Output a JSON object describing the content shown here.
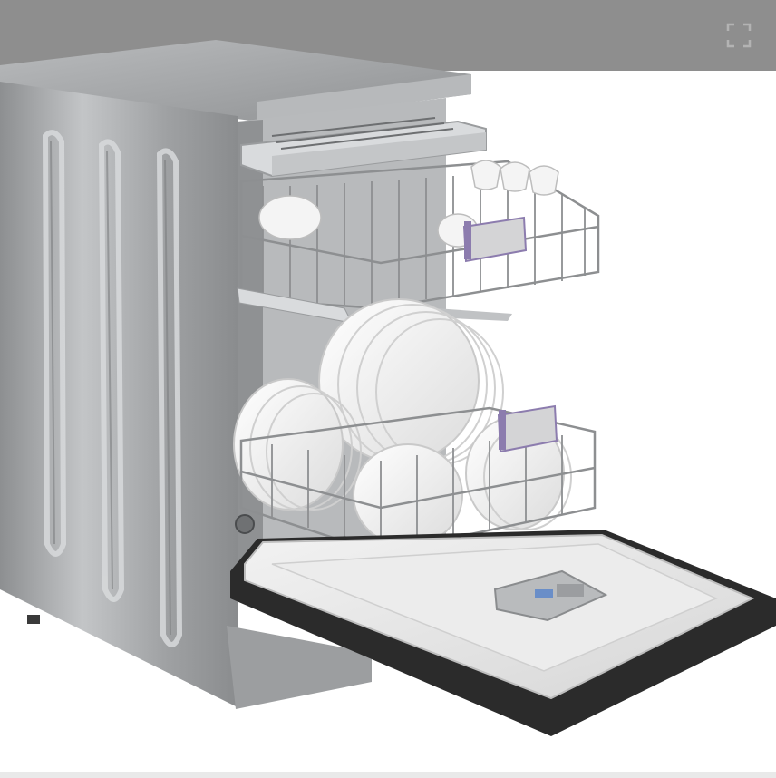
{
  "viewer": {
    "background": "#ffffff",
    "top_bar_color": "#8e8e8e",
    "controls": {
      "fullscreen": {
        "icon": "fullscreen-icon"
      }
    }
  },
  "image": {
    "subject": "dishwasher-product-photo",
    "body_color": "#a9abad",
    "door_color": "#2b2b2b",
    "rack_handle_color": "#8c7cae"
  }
}
